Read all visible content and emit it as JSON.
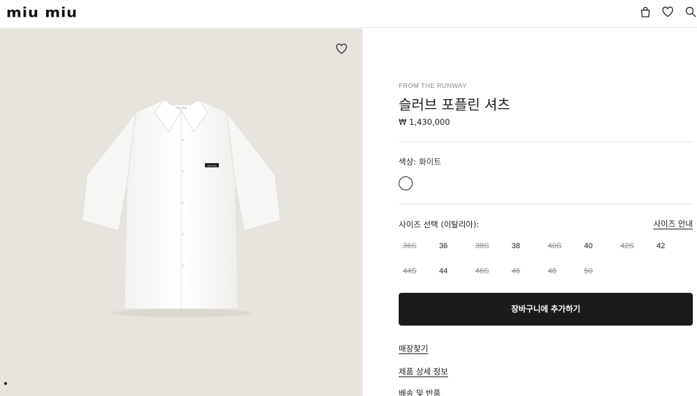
{
  "header": {
    "logo": "miu miu",
    "icons": [
      "bag-icon",
      "heart-icon",
      "search-icon"
    ]
  },
  "gallery": {
    "fav_icon": "heart-icon",
    "image_subject": "white short sleeve poplin shirt",
    "pagination": "dot-indicator"
  },
  "product": {
    "eyebrow": "FROM THE RUNWAY",
    "title": "슬러브 포플린 셔츠",
    "price": "₩ 1,430,000",
    "color_label": "색상:",
    "color_value": "화이트",
    "swatch_color": "#ffffff",
    "size_label": "사이즈 선택 (이탈리아):",
    "size_guide": "사이즈 안내",
    "sizes": [
      {
        "label": "36S",
        "available": false
      },
      {
        "label": "36",
        "available": true
      },
      {
        "label": "38S",
        "available": false
      },
      {
        "label": "38",
        "available": true
      },
      {
        "label": "40S",
        "available": false
      },
      {
        "label": "40",
        "available": true
      },
      {
        "label": "42S",
        "available": false
      },
      {
        "label": "42",
        "available": true
      },
      {
        "label": "44S",
        "available": false
      },
      {
        "label": "44",
        "available": true
      },
      {
        "label": "46S",
        "available": false
      },
      {
        "label": "46",
        "available": false
      },
      {
        "label": "48",
        "available": false
      },
      {
        "label": "50",
        "available": false
      }
    ],
    "add_to_cart": "장바구니에 추가하기",
    "links": [
      "매장찾기",
      "제품 상세 정보",
      "배송 및 반품"
    ]
  },
  "colors": {
    "text": "#1b1b1b",
    "button_bg": "#1b1b1b",
    "gallery_bg": "#e7e3dd",
    "muted": "#8c8c8c"
  }
}
